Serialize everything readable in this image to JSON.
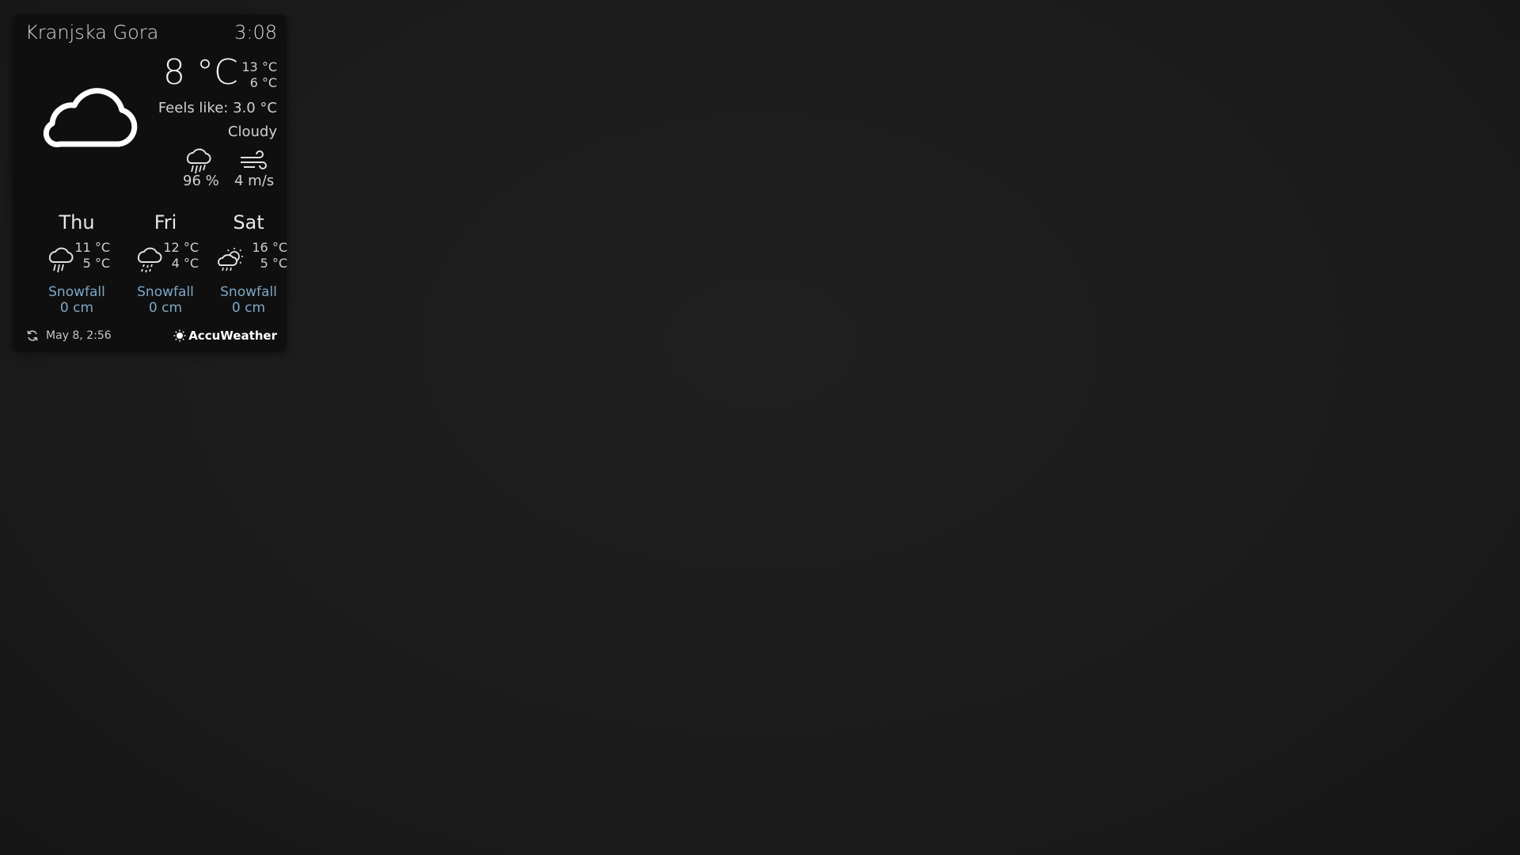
{
  "widget": {
    "location": "Kranjska Gora",
    "time": "3:08",
    "current": {
      "temp": "8 °C",
      "high": "13 °C",
      "low": "6 °C",
      "feels_like": "Feels like: 3.0 °C",
      "condition": "Cloudy",
      "icon": "cloud-icon",
      "precip": "96 %",
      "precip_icon": "rain-icon",
      "wind": "4 m/s",
      "wind_icon": "wind-icon"
    },
    "forecast": [
      {
        "day": "Thu",
        "high": "11 °C",
        "low": "5 °C",
        "icon": "rain-icon",
        "snow_label": "Snowfall",
        "snow_value": "0 cm"
      },
      {
        "day": "Fri",
        "high": "12 °C",
        "low": "4 °C",
        "icon": "showers-icon",
        "snow_label": "Snowfall",
        "snow_value": "0 cm"
      },
      {
        "day": "Sat",
        "high": "16 °C",
        "low": "5 °C",
        "icon": "sun-cloud-rain-icon",
        "snow_label": "Snowfall",
        "snow_value": "0 cm"
      }
    ],
    "updated": "May  8, 2:56",
    "provider": "AccuWeather"
  },
  "colors": {
    "background": "#1b1b1b",
    "widget_bg": "#0f0f0f",
    "text": "#e8e8e8",
    "snow_text": "#7fa8c7"
  }
}
